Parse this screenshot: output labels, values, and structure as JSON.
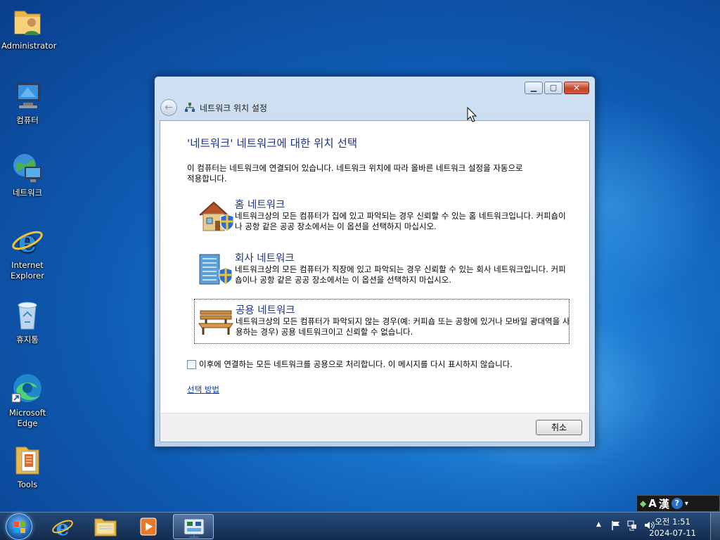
{
  "desktop": {
    "icons": [
      {
        "label": "Administrator"
      },
      {
        "label": "컴퓨터"
      },
      {
        "label": "네트워크"
      },
      {
        "label": "Internet Explorer"
      },
      {
        "label": "휴지통"
      },
      {
        "label": "Microsoft Edge"
      },
      {
        "label": "Tools"
      }
    ]
  },
  "window": {
    "nav_title": "네트워크 위치 설정",
    "heading": "'네트워크' 네트워크에 대한 위치 선택",
    "intro": "이 컴퓨터는 네트워크에 연결되어 있습니다. 네트워크 위치에 따라 올바른 네트워크 설정을 자동으로 적용합니다.",
    "options": [
      {
        "title": "홈 네트워크",
        "desc": "네트워크상의 모든 컴퓨터가 집에 있고 파악되는 경우 신뢰할 수 있는 홈 네트워크입니다. 커피숍이나 공항 같은 공공 장소에서는 이 옵션을 선택하지 마십시오."
      },
      {
        "title": "회사 네트워크",
        "desc": "네트워크상의 모든 컴퓨터가 직장에 있고 파악되는 경우 신뢰할 수 있는 회사 네트워크입니다. 커피숍이나 공항 같은 공공 장소에서는 이 옵션을 선택하지 마십시오."
      },
      {
        "title": "공용 네트워크",
        "desc": "네트워크상의 모든 컴퓨터가 파악되지 않는 경우(예: 커피숍 또는 공항에 있거나 모바일 광대역을 사용하는 경우) 공용 네트워크이고 신뢰할 수 없습니다."
      }
    ],
    "checkbox_label": "이후에 연결하는 모든 네트워크를 공용으로 처리합니다. 이 메시지를 다시 표시하지 않습니다.",
    "help_link": "선택 방법",
    "cancel_label": "취소"
  },
  "langbar": {
    "mode": "A",
    "hanja": "漢"
  },
  "taskbar": {
    "clock_time": "오전 1:51",
    "clock_date": "2024-07-11"
  }
}
